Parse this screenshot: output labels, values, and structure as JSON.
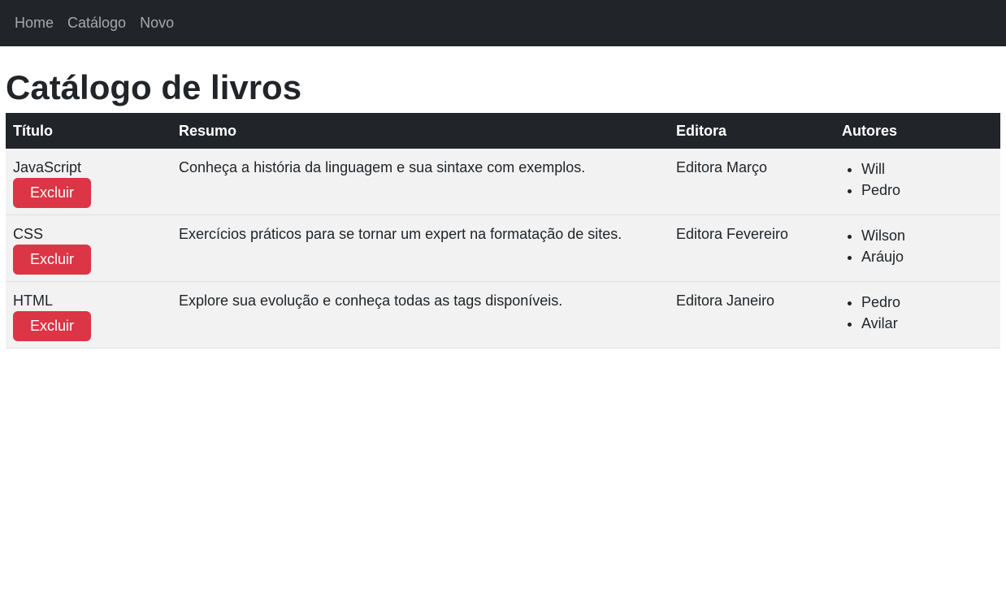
{
  "nav": {
    "items": [
      {
        "label": "Home"
      },
      {
        "label": "Catálogo"
      },
      {
        "label": "Novo"
      }
    ]
  },
  "page": {
    "title": "Catálogo de livros"
  },
  "table": {
    "headers": [
      "Título",
      "Resumo",
      "Editora",
      "Autores"
    ],
    "delete_label": "Excluir",
    "rows": [
      {
        "titulo": "JavaScript",
        "resumo": "Conheça a história da linguagem e sua sintaxe com exemplos.",
        "editora": "Editora Março",
        "autores": [
          "Will",
          "Pedro"
        ]
      },
      {
        "titulo": "CSS",
        "resumo": "Exercícios práticos para se tornar um expert na formatação de sites.",
        "editora": "Editora Fevereiro",
        "autores": [
          "Wilson",
          "Aráujo"
        ]
      },
      {
        "titulo": "HTML",
        "resumo": "Explore sua evolução e conheça todas as tags disponíveis.",
        "editora": "Editora Janeiro",
        "autores": [
          "Pedro",
          "Avilar"
        ]
      }
    ]
  },
  "colors": {
    "navbar": "#212529",
    "danger": "#dc3545",
    "row_background": "#f2f2f2"
  }
}
